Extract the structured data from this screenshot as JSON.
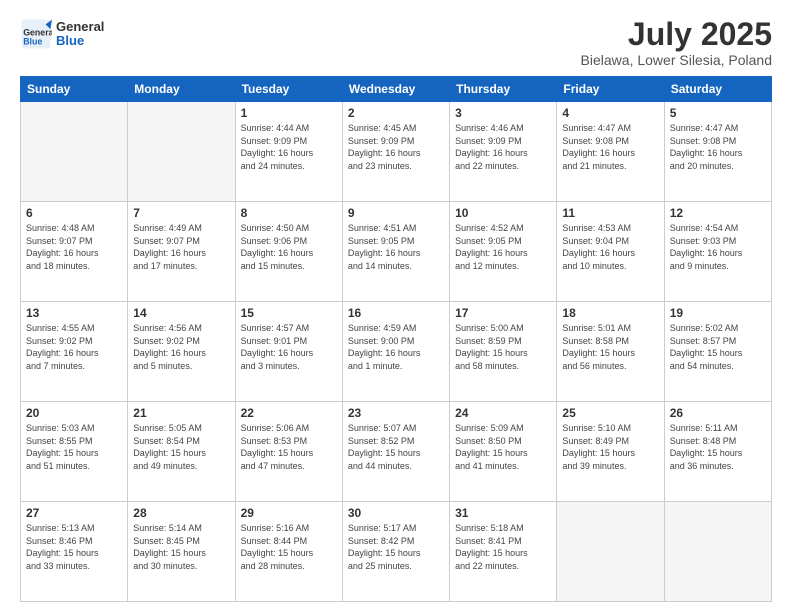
{
  "header": {
    "logo": {
      "line1": "General",
      "line2": "Blue"
    },
    "title": "July 2025",
    "subtitle": "Bielawa, Lower Silesia, Poland"
  },
  "weekdays": [
    "Sunday",
    "Monday",
    "Tuesday",
    "Wednesday",
    "Thursday",
    "Friday",
    "Saturday"
  ],
  "weeks": [
    [
      {
        "day": "",
        "info": ""
      },
      {
        "day": "",
        "info": ""
      },
      {
        "day": "1",
        "info": "Sunrise: 4:44 AM\nSunset: 9:09 PM\nDaylight: 16 hours\nand 24 minutes."
      },
      {
        "day": "2",
        "info": "Sunrise: 4:45 AM\nSunset: 9:09 PM\nDaylight: 16 hours\nand 23 minutes."
      },
      {
        "day": "3",
        "info": "Sunrise: 4:46 AM\nSunset: 9:09 PM\nDaylight: 16 hours\nand 22 minutes."
      },
      {
        "day": "4",
        "info": "Sunrise: 4:47 AM\nSunset: 9:08 PM\nDaylight: 16 hours\nand 21 minutes."
      },
      {
        "day": "5",
        "info": "Sunrise: 4:47 AM\nSunset: 9:08 PM\nDaylight: 16 hours\nand 20 minutes."
      }
    ],
    [
      {
        "day": "6",
        "info": "Sunrise: 4:48 AM\nSunset: 9:07 PM\nDaylight: 16 hours\nand 18 minutes."
      },
      {
        "day": "7",
        "info": "Sunrise: 4:49 AM\nSunset: 9:07 PM\nDaylight: 16 hours\nand 17 minutes."
      },
      {
        "day": "8",
        "info": "Sunrise: 4:50 AM\nSunset: 9:06 PM\nDaylight: 16 hours\nand 15 minutes."
      },
      {
        "day": "9",
        "info": "Sunrise: 4:51 AM\nSunset: 9:05 PM\nDaylight: 16 hours\nand 14 minutes."
      },
      {
        "day": "10",
        "info": "Sunrise: 4:52 AM\nSunset: 9:05 PM\nDaylight: 16 hours\nand 12 minutes."
      },
      {
        "day": "11",
        "info": "Sunrise: 4:53 AM\nSunset: 9:04 PM\nDaylight: 16 hours\nand 10 minutes."
      },
      {
        "day": "12",
        "info": "Sunrise: 4:54 AM\nSunset: 9:03 PM\nDaylight: 16 hours\nand 9 minutes."
      }
    ],
    [
      {
        "day": "13",
        "info": "Sunrise: 4:55 AM\nSunset: 9:02 PM\nDaylight: 16 hours\nand 7 minutes."
      },
      {
        "day": "14",
        "info": "Sunrise: 4:56 AM\nSunset: 9:02 PM\nDaylight: 16 hours\nand 5 minutes."
      },
      {
        "day": "15",
        "info": "Sunrise: 4:57 AM\nSunset: 9:01 PM\nDaylight: 16 hours\nand 3 minutes."
      },
      {
        "day": "16",
        "info": "Sunrise: 4:59 AM\nSunset: 9:00 PM\nDaylight: 16 hours\nand 1 minute."
      },
      {
        "day": "17",
        "info": "Sunrise: 5:00 AM\nSunset: 8:59 PM\nDaylight: 15 hours\nand 58 minutes."
      },
      {
        "day": "18",
        "info": "Sunrise: 5:01 AM\nSunset: 8:58 PM\nDaylight: 15 hours\nand 56 minutes."
      },
      {
        "day": "19",
        "info": "Sunrise: 5:02 AM\nSunset: 8:57 PM\nDaylight: 15 hours\nand 54 minutes."
      }
    ],
    [
      {
        "day": "20",
        "info": "Sunrise: 5:03 AM\nSunset: 8:55 PM\nDaylight: 15 hours\nand 51 minutes."
      },
      {
        "day": "21",
        "info": "Sunrise: 5:05 AM\nSunset: 8:54 PM\nDaylight: 15 hours\nand 49 minutes."
      },
      {
        "day": "22",
        "info": "Sunrise: 5:06 AM\nSunset: 8:53 PM\nDaylight: 15 hours\nand 47 minutes."
      },
      {
        "day": "23",
        "info": "Sunrise: 5:07 AM\nSunset: 8:52 PM\nDaylight: 15 hours\nand 44 minutes."
      },
      {
        "day": "24",
        "info": "Sunrise: 5:09 AM\nSunset: 8:50 PM\nDaylight: 15 hours\nand 41 minutes."
      },
      {
        "day": "25",
        "info": "Sunrise: 5:10 AM\nSunset: 8:49 PM\nDaylight: 15 hours\nand 39 minutes."
      },
      {
        "day": "26",
        "info": "Sunrise: 5:11 AM\nSunset: 8:48 PM\nDaylight: 15 hours\nand 36 minutes."
      }
    ],
    [
      {
        "day": "27",
        "info": "Sunrise: 5:13 AM\nSunset: 8:46 PM\nDaylight: 15 hours\nand 33 minutes."
      },
      {
        "day": "28",
        "info": "Sunrise: 5:14 AM\nSunset: 8:45 PM\nDaylight: 15 hours\nand 30 minutes."
      },
      {
        "day": "29",
        "info": "Sunrise: 5:16 AM\nSunset: 8:44 PM\nDaylight: 15 hours\nand 28 minutes."
      },
      {
        "day": "30",
        "info": "Sunrise: 5:17 AM\nSunset: 8:42 PM\nDaylight: 15 hours\nand 25 minutes."
      },
      {
        "day": "31",
        "info": "Sunrise: 5:18 AM\nSunset: 8:41 PM\nDaylight: 15 hours\nand 22 minutes."
      },
      {
        "day": "",
        "info": ""
      },
      {
        "day": "",
        "info": ""
      }
    ]
  ]
}
